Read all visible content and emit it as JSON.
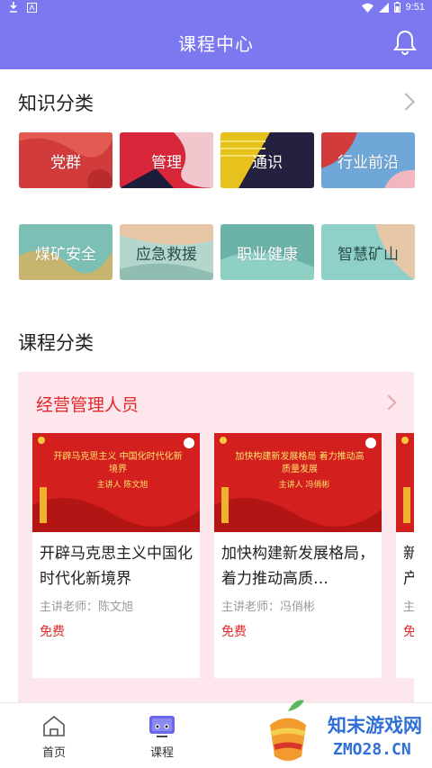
{
  "status_bar": {
    "time": "9:51"
  },
  "header": {
    "title": "课程中心"
  },
  "knowledge": {
    "title": "知识分类",
    "tiles": [
      {
        "label": "党群",
        "color": "#d23b3b"
      },
      {
        "label": "管理",
        "color": "#d8263a"
      },
      {
        "label": "通识",
        "color": "#e7c21c"
      },
      {
        "label": "行业前沿",
        "color": "#6fa7d8"
      },
      {
        "label": "煤矿安全",
        "color": "#7cc0b5"
      },
      {
        "label": "应急救援",
        "color": "#b5d6cc"
      },
      {
        "label": "职业健康",
        "color": "#6bb3a9"
      },
      {
        "label": "智慧矿山",
        "color": "#8fd1c9"
      }
    ]
  },
  "courses": {
    "title": "课程分类",
    "category": "经营管理人员",
    "items": [
      {
        "title": "开辟马克思主义中国化时代化新境界",
        "teacher": "主讲老师：陈文旭",
        "price": "免费",
        "banner_text": "开辟马克思主义 中国化时代化新境界",
        "banner_speaker": "主讲人 陈文旭"
      },
      {
        "title": "加快构建新发展格局，着力推动高质…",
        "teacher": "主讲老师：冯俏彬",
        "price": "免费",
        "banner_text": "加快构建新发展格局 着力推动高质量发展",
        "banner_speaker": "主讲人 冯俏彬"
      },
      {
        "title": "新产…",
        "teacher": "主",
        "price": "免"
      }
    ]
  },
  "tabs": [
    {
      "label": "首页",
      "icon": "home-icon"
    },
    {
      "label": "课程",
      "icon": "course-tv-icon"
    }
  ],
  "watermark": {
    "brand": "知末游戏网",
    "url": "ZMO28.CN"
  }
}
